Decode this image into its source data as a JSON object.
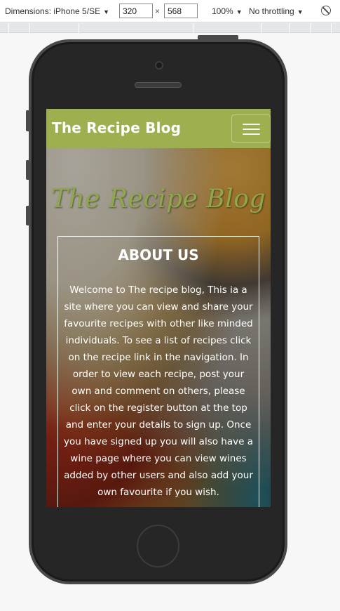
{
  "devtools": {
    "device_label": "Dimensions: iPhone 5/SE",
    "width_value": "320",
    "height_value": "568",
    "times_symbol": "×",
    "zoom_label": "100%",
    "throttle_label": "No throttling",
    "caret": "▼"
  },
  "site": {
    "brand": "The Recipe Blog",
    "hero_title": "The Recipe Blog",
    "about": {
      "heading": "ABOUT US",
      "body": "Welcome to The recipe blog, This ia a site where you can view and share your favourite recipes with other like minded individuals. To see a list of recipes click on the recipe link in the navigation. In order to view each recipe, post your own and comment on others, please click on the register button at the top and enter your details to sign up. Once you have signed up you will also have a wine page where you can view wines added by other users and also add your own favourite if you wish."
    }
  },
  "colors": {
    "navbar": "#9cb050",
    "hero_title": "#8ea84a",
    "phone_body": "#262626"
  }
}
